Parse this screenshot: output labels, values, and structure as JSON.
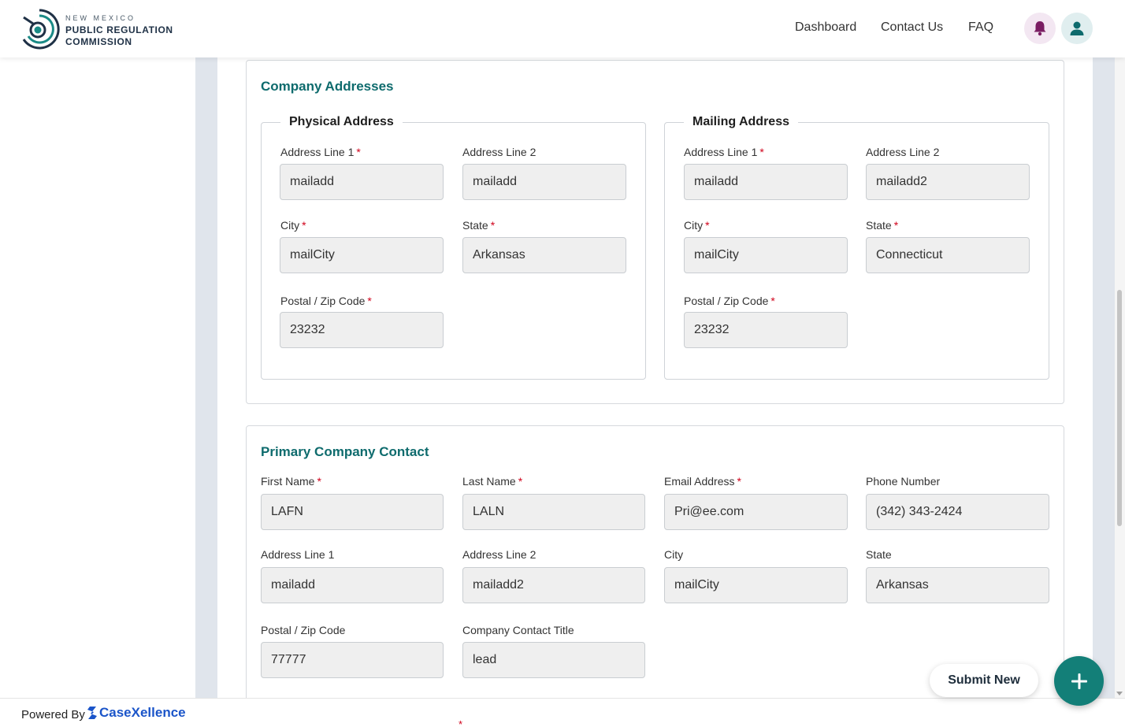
{
  "header": {
    "logo_small": "NEW MEXICO",
    "logo_line1": "PUBLIC REGULATION",
    "logo_line2": "COMMISSION",
    "nav": [
      "Dashboard",
      "Contact Us",
      "FAQ"
    ],
    "icons": {
      "notifications": "bell-icon",
      "account": "user-icon"
    },
    "colors": {
      "bell_bg": "#f3e7f2",
      "bell": "#7a1e63",
      "user_bg": "#e0eeef",
      "user": "#0e6b6d"
    }
  },
  "company_addresses": {
    "title": "Company Addresses",
    "physical": {
      "legend": "Physical Address",
      "address_line1_label": "Address Line 1",
      "address_line1": "mailadd",
      "address_line2_label": "Address Line 2",
      "address_line2": "mailadd",
      "city_label": "City",
      "city": "mailCity",
      "state_label": "State",
      "state": "Arkansas",
      "zip_label": "Postal / Zip Code",
      "zip": "23232"
    },
    "mailing": {
      "legend": "Mailing Address",
      "address_line1_label": "Address Line 1",
      "address_line1": "mailadd",
      "address_line2_label": "Address Line 2",
      "address_line2": "mailadd2",
      "city_label": "City",
      "city": "mailCity",
      "state_label": "State",
      "state": "Connecticut",
      "zip_label": "Postal / Zip Code",
      "zip": "23232"
    }
  },
  "primary_contact": {
    "title": "Primary Company Contact",
    "first_name_label": "First Name",
    "first_name": "LAFN",
    "last_name_label": "Last Name",
    "last_name": "LALN",
    "email_label": "Email Address",
    "email": "Pri@ee.com",
    "phone_label": "Phone Number",
    "phone": "(342) 343-2424",
    "address_line1_label": "Address Line 1",
    "address_line1": "mailadd",
    "address_line2_label": "Address Line 2",
    "address_line2": "mailadd2",
    "city_label": "City",
    "city": "mailCity",
    "state_label": "State",
    "state": "Arkansas",
    "zip_label": "Postal / Zip Code",
    "zip": "77777",
    "title_label": "Company Contact Title",
    "contact_title": "lead"
  },
  "required_marker": "*",
  "actions": {
    "submit_new": "Submit New",
    "fab_icon": "plus-icon"
  },
  "footer": {
    "powered_by": "Powered By",
    "brand": "CaseXellence",
    "required_marker": "*"
  },
  "colors": {
    "accent": "#0e6b6d",
    "fab": "#137f78",
    "required": "#d0021b",
    "brand": "#1b55c9"
  }
}
